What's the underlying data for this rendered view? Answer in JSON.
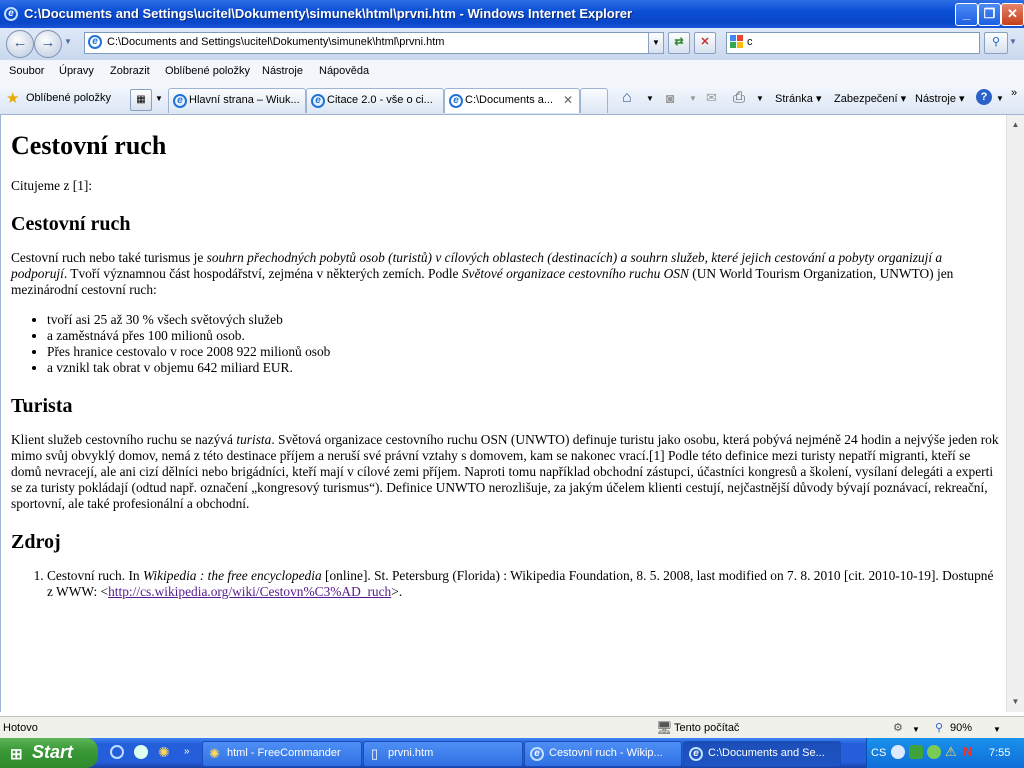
{
  "window": {
    "title": "C:\\Documents and Settings\\ucitel\\Dokumenty\\simunek\\html\\prvni.htm - Windows Internet Explorer"
  },
  "address_bar": {
    "url": "C:\\Documents and Settings\\ucitel\\Dokumenty\\simunek\\html\\prvni.htm"
  },
  "search": {
    "value": "c"
  },
  "menu": {
    "items": [
      "Soubor",
      "Úpravy",
      "Zobrazit",
      "Oblíbené položky",
      "Nástroje",
      "Nápověda"
    ]
  },
  "favorites": {
    "label": "Oblíbené položky"
  },
  "tabs": [
    {
      "label": "Hlavní strana – Wiuk..."
    },
    {
      "label": "Citace 2.0 - vše o ci..."
    },
    {
      "label": "C:\\Documents a..."
    }
  ],
  "commands": {
    "page": "Stránka",
    "security": "Zabezpečení",
    "tools": "Nástroje"
  },
  "page": {
    "h1": "Cestovní ruch",
    "intro": "Citujeme z [1]:",
    "s1_title": "Cestovní ruch",
    "s1_p_a": "Cestovní ruch nebo také turismus je ",
    "s1_p_em1": "souhrn přechodných pobytů osob (turistů) v cílových oblastech (destinacích) a souhrn služeb, které jejich cestování a pobyty organizují a podporují",
    "s1_p_b": ". Tvoří významnou část hospodářství, zejména v některých zemích. Podle ",
    "s1_p_em2": "Světové organizace cestovního ruchu OSN",
    "s1_p_c": " (UN World Tourism Organization, UNWTO) jen mezinárodní cestovní ruch:",
    "s1_list": [
      "tvoří asi 25 až 30 % všech světových služeb",
      "a zaměstnává přes 100 milionů osob.",
      "Přes hranice cestovalo v roce 2008 922 milionů osob",
      "a vznikl tak obrat v objemu 642 miliard EUR."
    ],
    "s2_title": "Turista",
    "s2_p_a": "Klient služeb cestovního ruchu se nazývá ",
    "s2_p_em": "turista",
    "s2_p_b": ". Světová organizace cestovního ruchu OSN (UNWTO) definuje turistu jako osobu, která pobývá nejméně 24 hodin a nejvýše jeden rok mimo svůj obvyklý domov, nemá z této destinace příjem a neruší své právní vztahy s domovem, kam se nakonec vrací.[1] Podle této definice mezi turisty nepatří migranti, kteří se domů nevracejí, ale ani cizí dělníci nebo brigádníci, kteří mají v cílové zemi příjem. Naproti tomu například obchodní zástupci, účastníci kongresů a školení, vysílaní delegáti a experti se za turisty pokládají (odtud např. označení „kongresový turismus“). Definice UNWTO nerozlišuje, za jakým účelem klienti cestují, nejčastnější důvody bývají poznávací, rekreační, sportovní, ale také profesionální a obchodní.",
    "s3_title": "Zdroj",
    "ref_a": "Cestovní ruch. In ",
    "ref_em": "Wikipedia : the free encyclopedia",
    "ref_b": " [online]. St. Petersburg (Florida) : Wikipedia Foundation, 8. 5. 2008, last modified on 7. 8. 2010 [cit. 2010-10-19]. Dostupné z WWW: <",
    "ref_link": "http://cs.wikipedia.org/wiki/Cestovn%C3%AD_ruch",
    "ref_c": ">."
  },
  "status": {
    "left": "Hotovo",
    "zone": "Tento počítač",
    "zoom": "90%"
  },
  "taskbar": {
    "start": "Start",
    "tasks": [
      {
        "label": "html - FreeCommander"
      },
      {
        "label": "prvni.htm"
      },
      {
        "label": "Cestovní ruch - Wikip..."
      },
      {
        "label": "C:\\Documents and Se..."
      }
    ],
    "lang": "CS",
    "time": "7:55"
  }
}
